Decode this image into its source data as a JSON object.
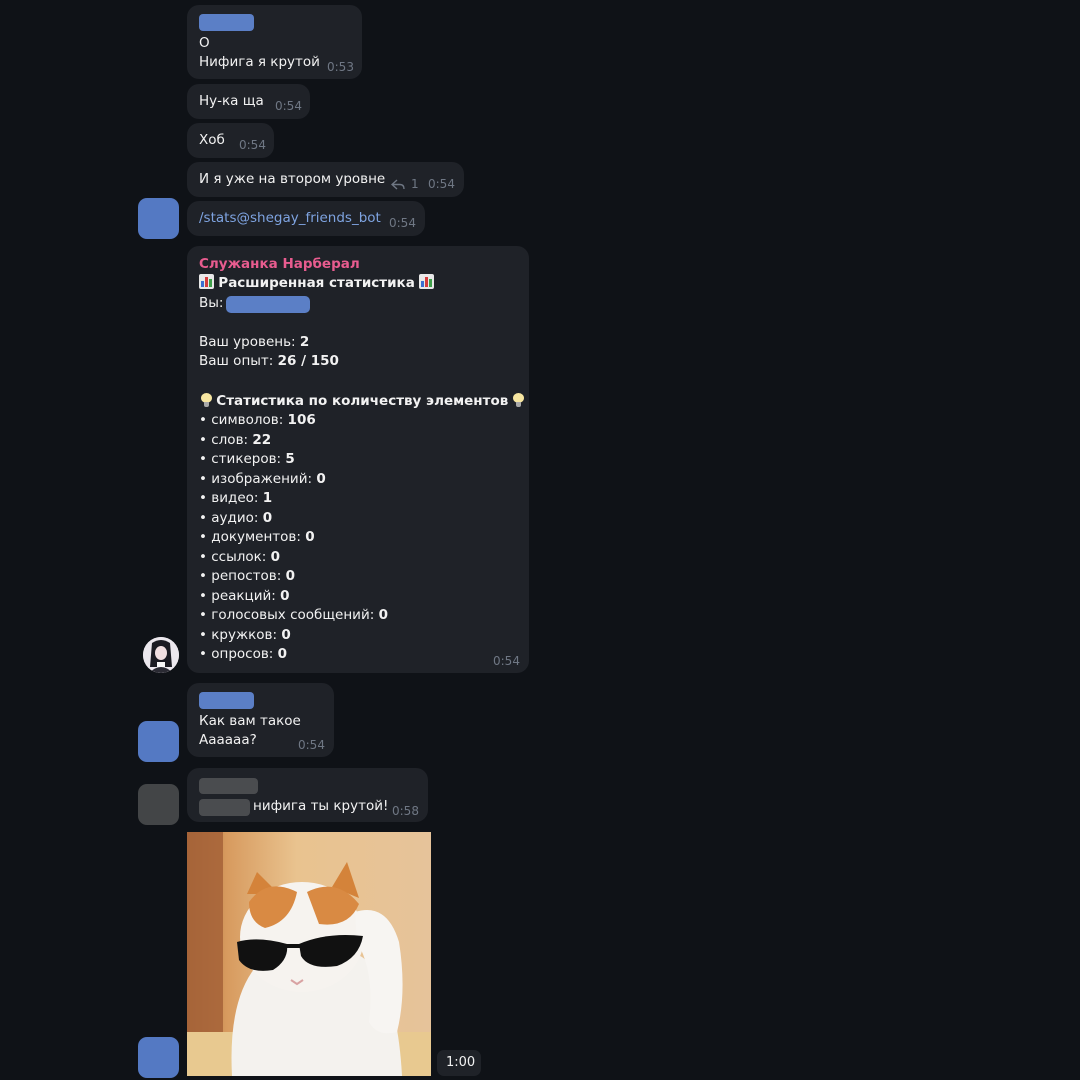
{
  "messages": {
    "m1": {
      "line1": "О",
      "line2": "Нифига я крутой",
      "time": "0:53"
    },
    "m2": {
      "text": "Ну-ка ща",
      "time": "0:54"
    },
    "m3": {
      "text": "Хоб",
      "time": "0:54"
    },
    "m4": {
      "text": "И я уже на втором уровне",
      "reply_icon": "reply-arrow-icon",
      "reply_count": "1",
      "time": "0:54"
    },
    "m5": {
      "text": "/stats@shegay_friends_bot",
      "time": "0:54"
    },
    "bot": {
      "sender": "Служанка Нарберал",
      "header": "Расширенная статистика",
      "you_label": "Вы:",
      "level_label": "Ваш уровень:",
      "level_value": "2",
      "exp_label": "Ваш опыт:",
      "exp_value": "26 / 150",
      "section_title": "Статистика по количеству элементов",
      "items": [
        {
          "label": "• символов:",
          "value": "106"
        },
        {
          "label": "• слов:",
          "value": "22"
        },
        {
          "label": "• стикеров:",
          "value": "5"
        },
        {
          "label": "• изображений:",
          "value": "0"
        },
        {
          "label": "• видео:",
          "value": "1"
        },
        {
          "label": "• аудио:",
          "value": "0"
        },
        {
          "label": "• документов:",
          "value": "0"
        },
        {
          "label": "• ссылок:",
          "value": "0"
        },
        {
          "label": "• репостов:",
          "value": "0"
        },
        {
          "label": "• реакций:",
          "value": "0"
        },
        {
          "label": "• голосовых сообщений:",
          "value": "0"
        },
        {
          "label": "• кружков:",
          "value": "0"
        },
        {
          "label": "• опросов:",
          "value": "0"
        }
      ],
      "time": "0:54"
    },
    "m6": {
      "line1": "Как вам такое",
      "line2": "Аааааа?",
      "time": "0:54"
    },
    "m7": {
      "text": "нифига ты крутой!",
      "time": "0:58"
    },
    "m8": {
      "media": "cat-with-sunglasses-gif",
      "duration": "1:00"
    }
  },
  "icons": {
    "chart": "bar-chart-icon",
    "bulb": "light-bulb-icon",
    "reply": "reply-arrow-icon"
  },
  "colors": {
    "background": "#0f1217",
    "bubble": "#1f2228",
    "bot_name": "#e85c8f",
    "link": "#7ea3e0",
    "time": "#6f7784",
    "redaction_blue": "#5b7fc6",
    "redaction_grey": "#4a4c4f"
  }
}
